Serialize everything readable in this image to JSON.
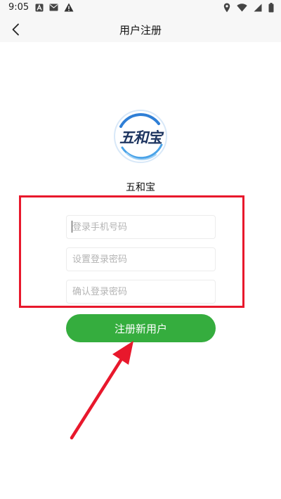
{
  "status_bar": {
    "time": "9:05",
    "left_icons": [
      "a-badge-icon",
      "mail-icon",
      "warning-icon"
    ],
    "right_icons": [
      "location-icon",
      "wifi-icon",
      "signal-icon",
      "battery-icon"
    ]
  },
  "header": {
    "title": "用户注册",
    "back_icon": "chevron-left-icon"
  },
  "logo": {
    "text": "五和宝",
    "ring_color": "#2f7fd6"
  },
  "app_name": "五和宝",
  "form": {
    "phone_placeholder": "登录手机号码",
    "password_placeholder": "设置登录密码",
    "confirm_placeholder": "确认登录密码",
    "submit_label": "注册新用户"
  },
  "colors": {
    "accent": "#35ad3e",
    "annotation": "#e8182c",
    "logo_text": "#1e3560"
  }
}
